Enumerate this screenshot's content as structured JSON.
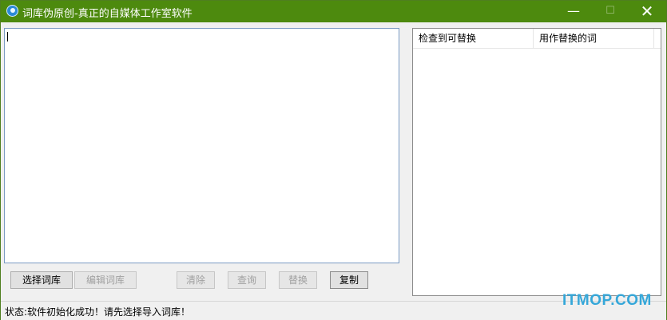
{
  "window": {
    "title": "词库伪原创-真正的自媒体工作室软件",
    "minimize_glyph": "—",
    "maximize_glyph": "☐",
    "close_glyph": "✕"
  },
  "editor": {
    "content": ""
  },
  "results": {
    "columns": [
      "检查到可替换",
      "用作替换的词"
    ],
    "rows": []
  },
  "buttons": {
    "select_library": "选择词库",
    "edit_library": "编辑词库",
    "clear": "清除",
    "query": "查询",
    "replace": "替换",
    "copy": "复制"
  },
  "status": {
    "text": "状态:软件初始化成功！请先选择导入词库！"
  },
  "watermark": {
    "text": "ITMOP.COM"
  },
  "colors": {
    "titlebar": "#4d8a0e",
    "watermark": "#35a7d9"
  }
}
